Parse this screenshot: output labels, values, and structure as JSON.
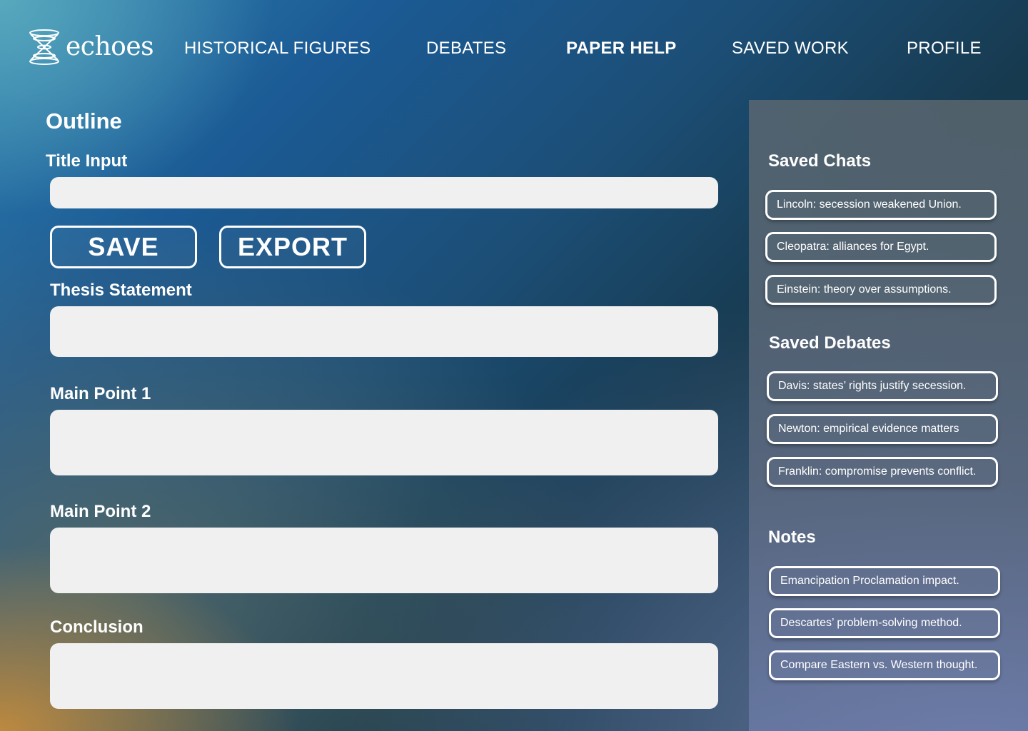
{
  "brand": {
    "name": "echoes",
    "icon": "hourglass-rings-logo"
  },
  "nav": {
    "items": [
      {
        "label": "HISTORICAL FIGURES",
        "active": false
      },
      {
        "label": "DEBATES",
        "active": false
      },
      {
        "label": "PAPER HELP",
        "active": true
      },
      {
        "label": "SAVED WORK",
        "active": false
      },
      {
        "label": "PROFILE",
        "active": false
      }
    ]
  },
  "outline": {
    "heading": "Outline",
    "title_label": "Title Input",
    "title_value": "",
    "buttons": {
      "save": "SAVE",
      "export": "EXPORT"
    },
    "thesis_label": "Thesis Statement",
    "thesis_value": "",
    "main_point_1_label": "Main Point 1",
    "main_point_1_value": "",
    "main_point_2_label": "Main Point 2",
    "main_point_2_value": "",
    "conclusion_label": "Conclusion",
    "conclusion_value": ""
  },
  "sidebar": {
    "saved_chats": {
      "heading": "Saved Chats",
      "items": [
        "Lincoln: secession weakened Union.",
        "Cleopatra: alliances for Egypt.",
        "Einstein: theory over assumptions."
      ]
    },
    "saved_debates": {
      "heading": "Saved Debates",
      "items": [
        "Davis: states’ rights justify secession.",
        "Newton: empirical evidence matters",
        "Franklin: compromise prevents conflict."
      ]
    },
    "notes": {
      "heading": "Notes",
      "items": [
        "Emancipation Proclamation impact.",
        "Descartes’ problem-solving method.",
        "Compare Eastern vs. Western thought."
      ]
    }
  },
  "colors": {
    "field_bg": "#f0f0f0",
    "text": "#ffffff",
    "sidebar_bg": "#5c6870"
  }
}
